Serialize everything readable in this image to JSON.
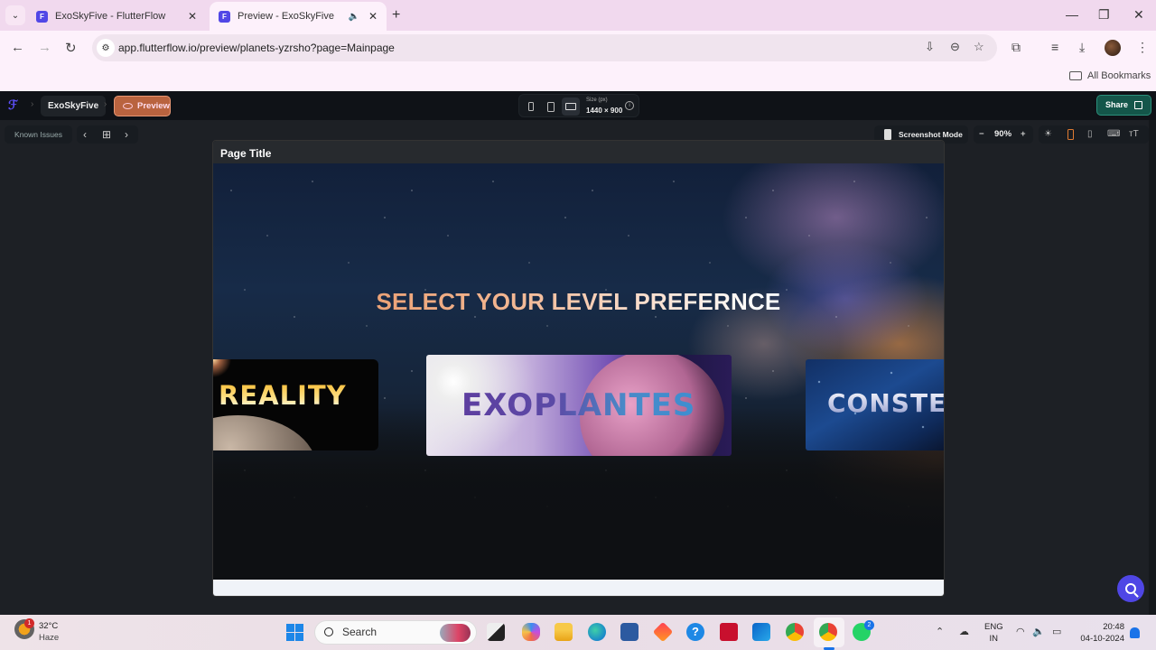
{
  "browser": {
    "tabs": [
      {
        "title": "ExoSkyFive - FlutterFlow",
        "favicon": "flutterflow-icon",
        "active": false
      },
      {
        "title": "Preview - ExoSkyFive",
        "favicon": "flutterflow-icon",
        "active": true,
        "audio": true
      }
    ],
    "url": "app.flutterflow.io/preview/planets-yzrsho?page=Mainpage",
    "bookmarks_label": "All Bookmarks",
    "glyphs": {
      "back": "←",
      "forward": "→",
      "reload": "↻",
      "tab_list": "⌄",
      "close": "✕",
      "new_tab": "+",
      "minimize": "—",
      "maximize": "❐",
      "win_close": "✕",
      "speaker": "🔈",
      "menu": "⋮",
      "install": "⇩",
      "zoom": "⊖",
      "star": "☆",
      "extensions": "⧉",
      "media": "≡",
      "download": "⤓",
      "tune": "⚙"
    }
  },
  "flutterflow": {
    "project_name": "ExoSkyFive",
    "preview_label": "Preview",
    "breadcrumb_sep": "›",
    "size_label": "Size (px)",
    "size_value": "1440 × 900",
    "share_label": "Share",
    "known_issues_label": "Known Issues",
    "nav_prev": "‹",
    "nav_grid": "⊞",
    "nav_next": "›",
    "screenshot_mode_label": "Screenshot Mode",
    "zoom_level": "90%",
    "zoom_minus": "−",
    "zoom_plus": "+",
    "tool_glyphs": {
      "sun": "☀",
      "tablet": "▯",
      "keyboard": "⌨",
      "text_size": "тT"
    },
    "info_glyph": "i"
  },
  "app_preview": {
    "page_title": "Page Title",
    "headline": "SELECT YOUR LEVEL PREFERNCE",
    "cards": [
      {
        "label": "REALITY"
      },
      {
        "label": "EXOPLANTES"
      },
      {
        "label": "CONSTE"
      }
    ],
    "accent_color": "#e48b57"
  },
  "taskbar": {
    "weather_temp": "32°C",
    "weather_condition": "Haze",
    "weather_badge": "1",
    "search_placeholder": "Search",
    "whatsapp_badge": "2",
    "language_line1": "ENG",
    "language_line2": "IN",
    "time": "20:48",
    "date": "04-10-2024",
    "tray_glyphs": {
      "chevron_up": "⌃",
      "cloud": "☁",
      "wifi": "◠",
      "volume": "🔈",
      "battery": "▭"
    },
    "app_glyphs": {
      "help": "?"
    }
  }
}
